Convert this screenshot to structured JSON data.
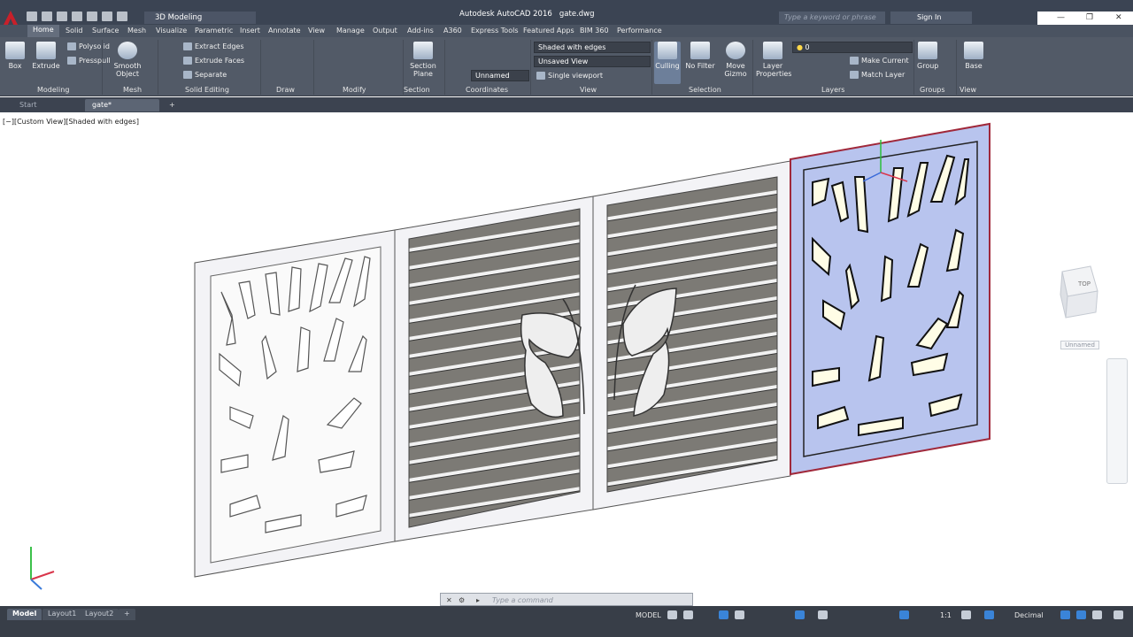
{
  "app": {
    "title": "Autodesk AutoCAD 2016",
    "file": "gate.dwg",
    "workspace": "3D Modeling",
    "search_placeholder": "Type a keyword or phrase",
    "signin": "Sign In"
  },
  "ribbon_tabs": [
    "Home",
    "Solid",
    "Surface",
    "Mesh",
    "Visualize",
    "Parametric",
    "Insert",
    "Annotate",
    "View",
    "Manage",
    "Output",
    "Add-ins",
    "A360",
    "Express Tools",
    "Featured Apps",
    "BIM 360",
    "Performance"
  ],
  "ribbon": {
    "modeling": {
      "box": "Box",
      "extrude": "Extrude",
      "polysolid": "Polysolid",
      "presspull": "Presspull",
      "panel": "Modeling"
    },
    "mesh": {
      "smooth": "Smooth",
      "object": "Object",
      "panel": "Mesh"
    },
    "solid_editing": {
      "extract": "Extract Edges",
      "extrude_faces": "Extrude Faces",
      "separate": "Separate",
      "panel": "Solid Editing"
    },
    "draw": {
      "panel": "Draw"
    },
    "modify": {
      "panel": "Modify"
    },
    "section": {
      "plane1": "Section",
      "plane2": "Plane",
      "panel": "Section"
    },
    "coordinates": {
      "ucs": "Unnamed",
      "panel": "Coordinates"
    },
    "view": {
      "visual_style": "Shaded with edges",
      "saved_view": "Unsaved View",
      "viewport": "Single viewport",
      "panel": "View"
    },
    "selection": {
      "culling": "Culling",
      "no_filter": "No Filter",
      "move": "Move",
      "gizmo": "Gizmo",
      "panel": "Selection"
    },
    "layers": {
      "layer_props1": "Layer",
      "layer_props2": "Properties",
      "layer_current": "0",
      "make_current": "Make Current",
      "match_layer": "Match Layer",
      "panel": "Layers"
    },
    "groups": {
      "group": "Group",
      "panel": "Groups"
    },
    "viewp": {
      "base": "Base",
      "panel": "View"
    }
  },
  "doc_tabs": [
    "Start",
    "gate*"
  ],
  "viewport": {
    "label": "[−][Custom View][Shaded with edges]",
    "viewcube_face": "TOP",
    "viewcube_menu": "Unnamed"
  },
  "command": {
    "placeholder": "Type a command"
  },
  "layout_tabs": [
    "Model",
    "Layout1",
    "Layout2"
  ],
  "status": {
    "model": "MODEL",
    "scale": "1:1",
    "units": "Decimal"
  },
  "colors": {
    "titlebar": "#3b4453",
    "ribbon": "#525a67",
    "statusbar": "#383e48",
    "selection": "#b8c4ee",
    "selection_edge": "#a0283a"
  }
}
